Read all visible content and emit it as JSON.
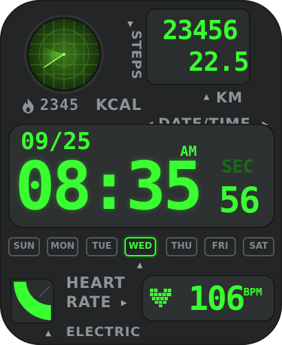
{
  "steps": {
    "value": "23456",
    "label": "STEPS"
  },
  "distance": {
    "value": "22.5",
    "label": "KM"
  },
  "calories": {
    "value": "2345",
    "unit": "KCAL"
  },
  "datetime": {
    "label": "DATE/TIME",
    "date": "09/25",
    "ampm": "AM",
    "time": "08:35",
    "sec_label": "SEC",
    "seconds": "56"
  },
  "weekdays": [
    "SUN",
    "MON",
    "TUE",
    "WED",
    "THU",
    "FRI",
    "SAT"
  ],
  "selected_day": "WED",
  "heart": {
    "label_line1": "HEART",
    "label_line2": "RATE",
    "value": "106",
    "unit": "BPM"
  },
  "electric": {
    "label": "ELECTRIC"
  },
  "colors": {
    "accent": "#39ff30",
    "background": "#232526",
    "label_gray": "#8e9396"
  }
}
